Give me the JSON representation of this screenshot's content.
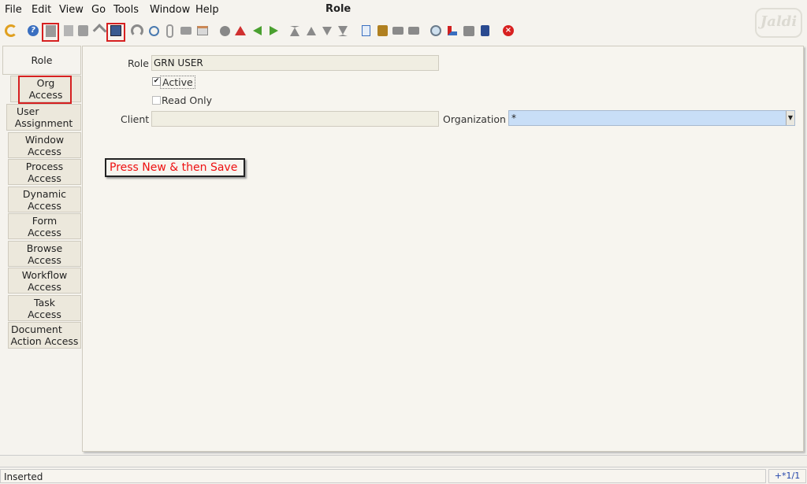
{
  "menu": {
    "file": "File",
    "edit": "Edit",
    "view": "View",
    "go": "Go",
    "tools": "Tools",
    "window": "Window",
    "help": "Help"
  },
  "window_title": "Role",
  "logo_text": "Jaldi",
  "toolbar": {
    "icons": [
      "undo-icon",
      "help-icon",
      "new-record-icon",
      "copy-record-icon",
      "delete-icon",
      "delete-selection-icon",
      "save-icon",
      "refresh-icon",
      "find-icon",
      "attachment-icon",
      "chat-icon",
      "history-icon",
      "grid-toggle-icon",
      "home-icon",
      "parent-icon",
      "detail-icon",
      "first-record-icon",
      "previous-record-icon",
      "next-record-icon",
      "last-record-icon",
      "report-icon",
      "archive-icon",
      "print-preview-icon",
      "print-icon",
      "zoom-across-icon",
      "workflow-icon",
      "active-workflows-icon",
      "requests-icon",
      "product-info-icon",
      "exit-icon"
    ]
  },
  "tabs": [
    {
      "label": "Role"
    },
    {
      "label": "Org Access"
    },
    {
      "label": "User Assignment"
    },
    {
      "label": "Window Access"
    },
    {
      "label": "Process Access"
    },
    {
      "label": "Dynamic Access"
    },
    {
      "label": "Form Access"
    },
    {
      "label": "Browse Access"
    },
    {
      "label": "Workflow Access"
    },
    {
      "label": "Task Access"
    },
    {
      "label": "Document Action Access"
    }
  ],
  "tab_lines": [
    [
      "Role"
    ],
    [
      "Org",
      "Access"
    ],
    [
      "User",
      "Assignment"
    ],
    [
      "Window",
      "Access"
    ],
    [
      "Process",
      "Access"
    ],
    [
      "Dynamic",
      "Access"
    ],
    [
      "Form",
      "Access"
    ],
    [
      "Browse",
      "Access"
    ],
    [
      "Workflow",
      "Access"
    ],
    [
      "Task",
      "Access"
    ],
    [
      "Document",
      "Action Access"
    ]
  ],
  "form": {
    "role_label": "Role",
    "role_value": "GRN USER",
    "active_label": "Active",
    "active_checked": true,
    "readonly_label": "Read Only",
    "readonly_checked": false,
    "client_label": "Client",
    "client_value": "",
    "organization_label": "Organization",
    "organization_value": "*"
  },
  "callout": "Press New & then Save",
  "status": {
    "message": "Inserted",
    "record_info": "+*1/1"
  },
  "colors": {
    "highlight_border": "#d62020",
    "callout_text": "#e11111",
    "selected_field_bg": "#c8def7"
  }
}
